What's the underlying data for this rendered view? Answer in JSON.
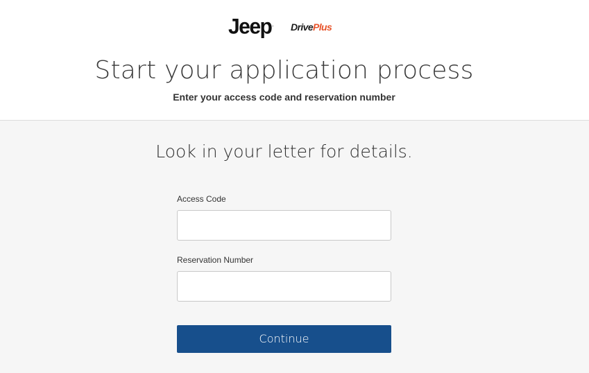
{
  "header": {
    "brand_logo": "Jeep",
    "brand_logo_mark": ".",
    "partner_logo_part1": "Drive",
    "partner_logo_part2": "Plus",
    "title": "Start your application process",
    "subtitle": "Enter your access code and reservation number"
  },
  "form": {
    "heading": "Look in your letter for details.",
    "access_code_label": "Access Code",
    "access_code_value": "",
    "reservation_number_label": "Reservation Number",
    "reservation_number_value": "",
    "continue_label": "Continue"
  },
  "colors": {
    "primary_button": "#174f8c",
    "accent_orange": "#e8542b",
    "form_background": "#f6f6f6"
  }
}
